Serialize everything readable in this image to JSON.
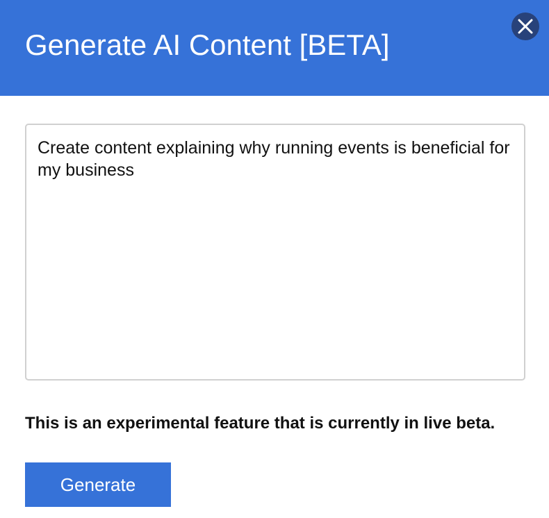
{
  "modal": {
    "title": "Generate AI Content [BETA]",
    "close_icon": "close-x-icon"
  },
  "prompt": {
    "value": "Create content explaining why running events is beneficial for my business"
  },
  "notice": {
    "text": "This is an experimental feature that is currently in live beta."
  },
  "actions": {
    "generate_label": "Generate"
  },
  "colors": {
    "header_background": "#3672d8",
    "close_button_background": "#28427a",
    "button_background": "#3672d8",
    "input_border": "#d0d0d0"
  }
}
